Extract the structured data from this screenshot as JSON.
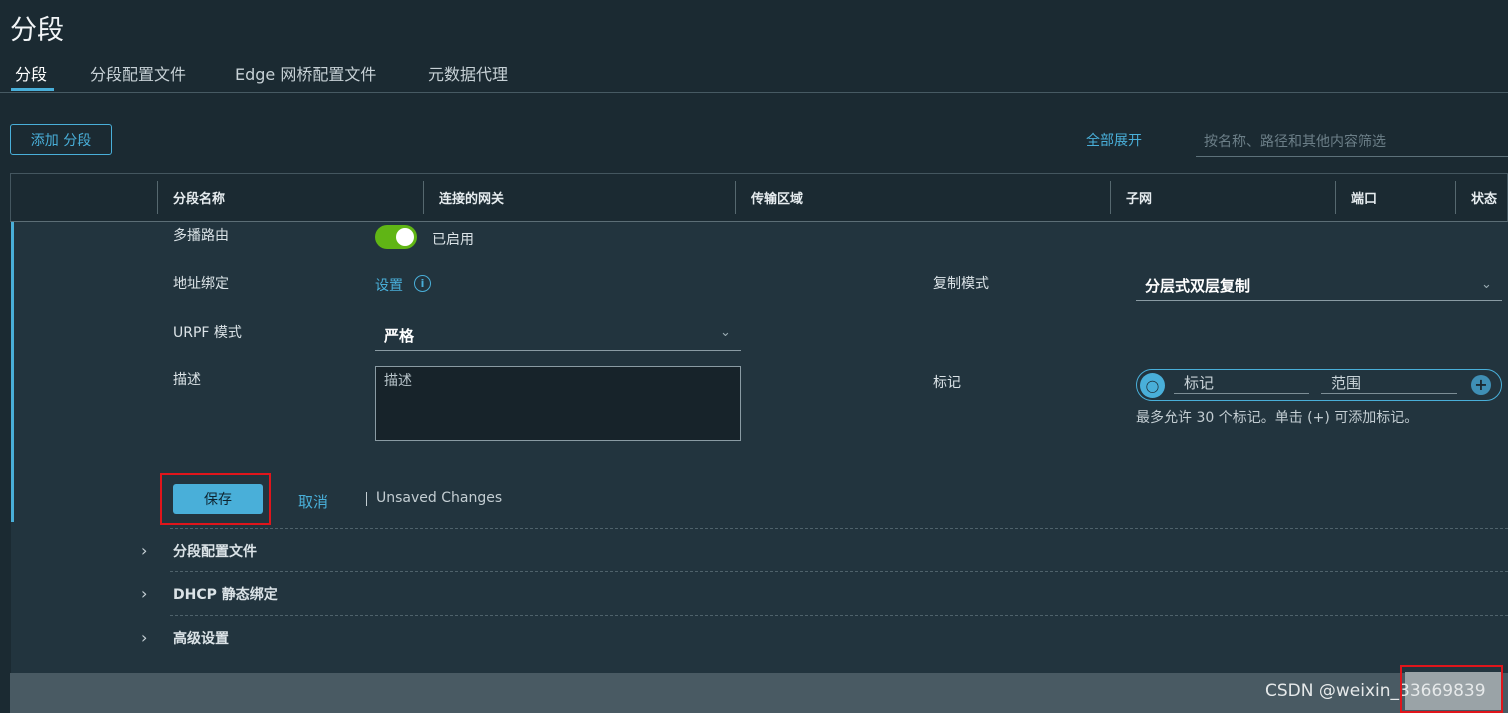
{
  "page": {
    "title": "分段"
  },
  "tabs": [
    {
      "label": "分段",
      "active": true
    },
    {
      "label": "分段配置文件"
    },
    {
      "label": "Edge 网桥配置文件"
    },
    {
      "label": "元数据代理"
    }
  ],
  "toolbar": {
    "add_button": "添加 分段",
    "expand_all": "全部展开",
    "filter_placeholder": "按名称、路径和其他内容筛选"
  },
  "table": {
    "columns": [
      "分段名称",
      "连接的网关",
      "传输区域",
      "子网",
      "端口",
      "状态"
    ]
  },
  "form": {
    "multicast_label": "多播路由",
    "multicast_status": "已启用",
    "address_binding_label": "地址绑定",
    "address_binding_link": "设置",
    "replication_label": "复制模式",
    "replication_value": "分层式双层复制",
    "urpf_label": "URPF 模式",
    "urpf_value": "严格",
    "description_label": "描述",
    "description_placeholder": "描述",
    "tags_label": "标记",
    "tag_placeholder": "标记",
    "scope_placeholder": "范围",
    "tags_hint": "最多允许 30 个标记。单击 (+) 可添加标记。",
    "save_button": "保存",
    "cancel_button": "取消",
    "unsaved": "Unsaved Changes"
  },
  "sections": [
    {
      "label": "分段配置文件"
    },
    {
      "label": "DHCP 静态绑定"
    },
    {
      "label": "高级设置"
    }
  ],
  "watermark": "CSDN @weixin_33669839",
  "colors": {
    "accent": "#49afd9",
    "toggle_on": "#60b515",
    "highlight": "#e0151b"
  }
}
